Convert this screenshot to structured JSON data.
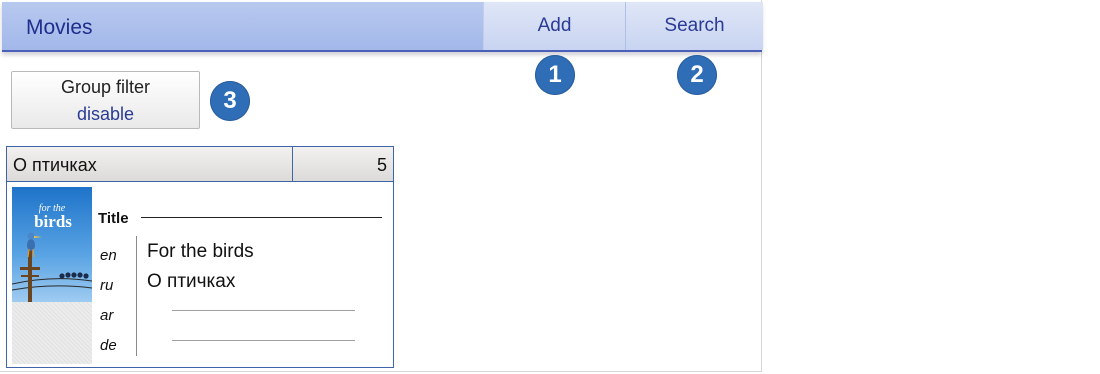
{
  "header": {
    "title": "Movies",
    "add_label": "Add",
    "search_label": "Search"
  },
  "badges": [
    "1",
    "2",
    "3"
  ],
  "group_filter": {
    "title": "Group filter",
    "state": "disable"
  },
  "movie_card": {
    "name": "О птичках",
    "count": "5",
    "poster_icon": "for-the-birds-poster",
    "field_label": "Title",
    "titles": [
      {
        "lang": "en",
        "value": "For the birds"
      },
      {
        "lang": "ru",
        "value": "О птичках"
      },
      {
        "lang": "ar",
        "value": ""
      },
      {
        "lang": "de",
        "value": ""
      }
    ]
  },
  "colors": {
    "header_bg": "#a9bcec",
    "accent": "#2a3b95",
    "badge": "#2f6db6",
    "card_border": "#3f64a8"
  }
}
